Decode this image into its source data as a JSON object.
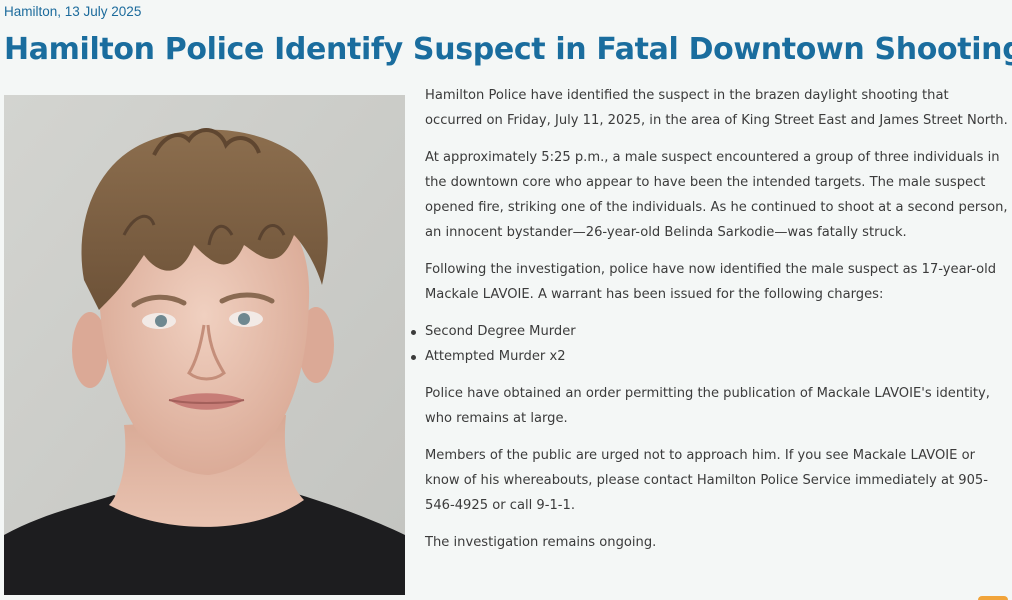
{
  "dateline": "Hamilton, 13 July 2025",
  "headline": "Hamilton Police Identify Suspect in Fatal Downtown Shooting",
  "photo": {
    "icon": "suspect-photo"
  },
  "article": {
    "paragraphs": [
      "Hamilton Police have identified the suspect in the brazen daylight shooting that occurred on Friday, July 11, 2025, in the area of King Street East and James Street North.",
      "At approximately 5:25 p.m., a male suspect encountered a group of three individuals in the downtown core who appear to have been the intended targets. The male suspect opened fire, striking one of the individuals. As he continued to shoot at a second person, an innocent bystander—26-year-old Belinda Sarkodie—was fatally struck.",
      "Following the investigation, police have now identified the male suspect as 17-year-old Mackale LAVOIE. A warrant has been issued for the following charges:"
    ],
    "charges": [
      "Second Degree Murder",
      "Attempted Murder x2"
    ],
    "paragraphs_after": [
      "Police have obtained an order permitting the publication of Mackale LAVOIE's identity, who remains at large.",
      "Members of the public are urged not to approach him. If you see Mackale LAVOIE or know of his whereabouts, please contact Hamilton Police Service immediately at 905-546-4925 or call 9-1-1.",
      "The investigation remains ongoing."
    ]
  },
  "colors": {
    "headline": "#1a6d9e",
    "body_text": "#3b3b3b",
    "background": "#f4f7f6",
    "accent_tab": "#f1a43a"
  }
}
